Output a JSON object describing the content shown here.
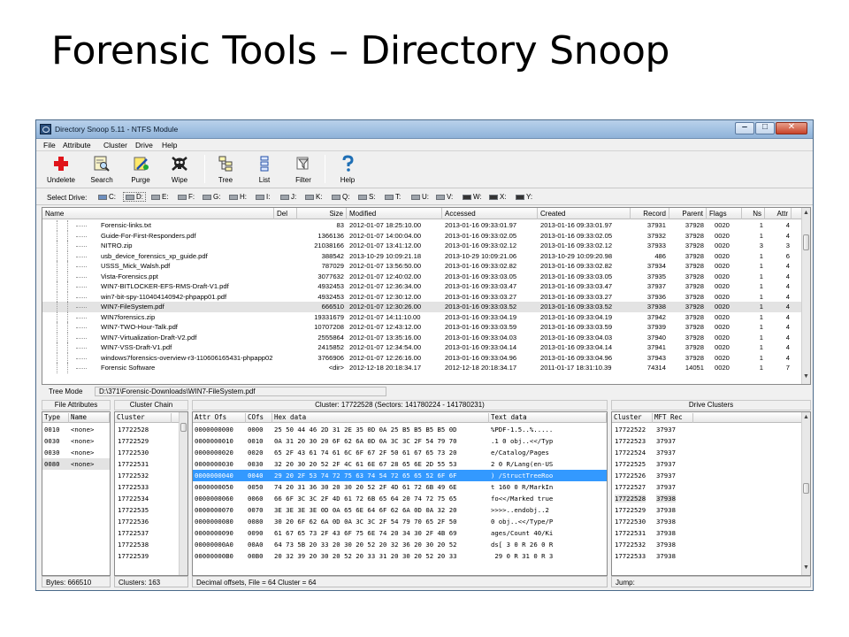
{
  "slide": {
    "title": "Forensic Tools – Directory Snoop"
  },
  "window": {
    "title": "Directory Snoop 5.11 - NTFS Module",
    "buttons": {
      "minimize": "‒",
      "maximize": "□",
      "close": "✕"
    }
  },
  "menu": [
    "File",
    "Attribute",
    "Cluster",
    "Drive",
    "Help"
  ],
  "toolbar": [
    {
      "label": "Undelete",
      "icon": "red-cross-icon"
    },
    {
      "label": "Search",
      "icon": "search-icon"
    },
    {
      "label": "Purge",
      "icon": "purge-icon"
    },
    {
      "label": "Wipe",
      "icon": "skull-icon"
    },
    {
      "label": "Tree",
      "icon": "tree-icon"
    },
    {
      "label": "List",
      "icon": "list-icon"
    },
    {
      "label": "Filter",
      "icon": "filter-icon"
    },
    {
      "label": "Help",
      "icon": "question-icon"
    }
  ],
  "drives": {
    "label": "Select Drive:",
    "items": [
      "C:",
      "D:",
      "E:",
      "F:",
      "G:",
      "H:",
      "I:",
      "J:",
      "K:",
      "Q:",
      "S:",
      "T:",
      "U:",
      "V:",
      "W:",
      "X:",
      "Y:"
    ],
    "selected": "C:"
  },
  "file_list": {
    "columns": [
      "Name",
      "Del",
      "Size",
      "Modified",
      "Accessed",
      "Created",
      "Record",
      "Parent",
      "Flags",
      "Ns",
      "Attr"
    ],
    "rows": [
      [
        "Forensic-links.txt",
        "",
        "83",
        "2012-01-07 18:25:10.00",
        "2013-01-16 09:33:01.97",
        "2013-01-16 09:33:01.97",
        "37931",
        "37928",
        "0020",
        "1",
        "4"
      ],
      [
        "Guide-For-First-Responders.pdf",
        "",
        "1366136",
        "2012-01-07 14:00:04.00",
        "2013-01-16 09:33:02.05",
        "2013-01-16 09:33:02.05",
        "37932",
        "37928",
        "0020",
        "1",
        "4"
      ],
      [
        "NITRO.zip",
        "",
        "21038166",
        "2012-01-07 13:41:12.00",
        "2013-01-16 09:33:02.12",
        "2013-01-16 09:33:02.12",
        "37933",
        "37928",
        "0020",
        "3",
        "3"
      ],
      [
        "usb_device_forensics_xp_guide.pdf",
        "",
        "388542",
        "2013-10-29 10:09:21.18",
        "2013-10-29 10:09:21.06",
        "2013-10-29 10:09:20.98",
        "486",
        "37928",
        "0020",
        "1",
        "6"
      ],
      [
        "USSS_Mick_Walsh.pdf",
        "",
        "787029",
        "2012-01-07 13:56:50.00",
        "2013-01-16 09:33:02.82",
        "2013-01-16 09:33:02.82",
        "37934",
        "37928",
        "0020",
        "1",
        "4"
      ],
      [
        "Vista-Forensics.ppt",
        "",
        "3077632",
        "2012-01-07 12:40:02.00",
        "2013-01-16 09:33:03.05",
        "2013-01-16 09:33:03.05",
        "37935",
        "37928",
        "0020",
        "1",
        "4"
      ],
      [
        "WIN7-BITLOCKER-EFS-RMS-Draft-V1.pdf",
        "",
        "4932453",
        "2012-01-07 12:36:34.00",
        "2013-01-16 09:33:03.47",
        "2013-01-16 09:33:03.47",
        "37937",
        "37928",
        "0020",
        "1",
        "4"
      ],
      [
        "win7-bit-spy-110404140942-phpapp01.pdf",
        "",
        "4932453",
        "2012-01-07 12:30:12.00",
        "2013-01-16 09:33:03.27",
        "2013-01-16 09:33:03.27",
        "37936",
        "37928",
        "0020",
        "1",
        "4"
      ],
      [
        "WIN7-FileSystem.pdf",
        "",
        "666510",
        "2012-01-07 12:30:26.00",
        "2013-01-16 09:33:03.52",
        "2013-01-16 09:33:03.52",
        "37938",
        "37928",
        "0020",
        "1",
        "4"
      ],
      [
        "WIN7forensics.zip",
        "",
        "19331679",
        "2012-01-07 14:11:10.00",
        "2013-01-16 09:33:04.19",
        "2013-01-16 09:33:04.19",
        "37942",
        "37928",
        "0020",
        "1",
        "4"
      ],
      [
        "WIN7-TWO-Hour-Talk.pdf",
        "",
        "10707208",
        "2012-01-07 12:43:12.00",
        "2013-01-16 09:33:03.59",
        "2013-01-16 09:33:03.59",
        "37939",
        "37928",
        "0020",
        "1",
        "4"
      ],
      [
        "WIN7-Virtualization-Draft-V2.pdf",
        "",
        "2555864",
        "2012-01-07 13:35:16.00",
        "2013-01-16 09:33:04.03",
        "2013-01-16 09:33:04.03",
        "37940",
        "37928",
        "0020",
        "1",
        "4"
      ],
      [
        "WIN7-VSS-Draft-V1.pdf",
        "",
        "2415852",
        "2012-01-07 12:34:54.00",
        "2013-01-16 09:33:04.14",
        "2013-01-16 09:33:04.14",
        "37941",
        "37928",
        "0020",
        "1",
        "4"
      ],
      [
        "windows7forensics-overview-r3-110606165431-phpapp02....",
        "",
        "3766906",
        "2012-01-07 12:26:16.00",
        "2013-01-16 09:33:04.96",
        "2013-01-16 09:33:04.96",
        "37943",
        "37928",
        "0020",
        "1",
        "4"
      ],
      [
        "Forensic Software",
        "",
        "<dir>",
        "2012-12-18 20:18:34.17",
        "2012-12-18 20:18:34.17",
        "2011-01-17 18:31:10.39",
        "74314",
        "14051",
        "0020",
        "1",
        "7"
      ]
    ],
    "selected_index": 8
  },
  "tree_mode": {
    "label": "Tree Mode",
    "path": "D:\\371\\Forensic-Downloads\\WIN7-FileSystem.pdf"
  },
  "file_attributes": {
    "title": "File Attributes",
    "columns": [
      "Type",
      "Name"
    ],
    "rows": [
      [
        "0010",
        "<none>"
      ],
      [
        "0030",
        "<none>"
      ],
      [
        "0030",
        "<none>"
      ],
      [
        "0080",
        "<none>"
      ]
    ],
    "selected_index": 3
  },
  "cluster_chain": {
    "title": "Cluster Chain",
    "column": "Cluster",
    "rows": [
      "17722528",
      "17722529",
      "17722530",
      "17722531",
      "17722532",
      "17722533",
      "17722534",
      "17722535",
      "17722536",
      "17722537",
      "17722538",
      "17722539"
    ]
  },
  "hex_view": {
    "title": "Cluster: 17722528  (Sectors: 141780224 - 141780231)",
    "columns": [
      "Attr Ofs",
      "COfs",
      "Hex data",
      "Text data"
    ],
    "rows": [
      [
        "0000000000",
        "0000",
        "25 50 44 46 2D 31 2E 35 0D 0A 25 B5 B5 B5 B5 0D",
        "%PDF-1.5..%....."
      ],
      [
        "0000000010",
        "0010",
        "0A 31 20 30 20 6F 62 6A 0D 0A 3C 3C 2F 54 79 70",
        ".1 0 obj..<</Typ"
      ],
      [
        "0000000020",
        "0020",
        "65 2F 43 61 74 61 6C 6F 67 2F 50 61 67 65 73 20",
        "e/Catalog/Pages "
      ],
      [
        "0000000030",
        "0030",
        "32 20 30 20 52 2F 4C 61 6E 67 28 65 6E 2D 55 53",
        "2 0 R/Lang(en-US"
      ],
      [
        "0000000040",
        "0040",
        "29 20 2F 53 74 72 75 63 74 54 72 65 65 52 6F 6F",
        ") /StructTreeRoo"
      ],
      [
        "0000000050",
        "0050",
        "74 20 31 36 30 20 30 20 52 2F 4D 61 72 6B 49 6E",
        "t 160 0 R/MarkIn"
      ],
      [
        "0000000060",
        "0060",
        "66 6F 3C 3C 2F 4D 61 72 6B 65 64 20 74 72 75 65",
        "fo<</Marked true"
      ],
      [
        "0000000070",
        "0070",
        "3E 3E 3E 3E 0D 0A 65 6E 64 6F 62 6A 0D 0A 32 20",
        ">>>>..endobj..2 "
      ],
      [
        "0000000080",
        "0080",
        "30 20 6F 62 6A 0D 0A 3C 3C 2F 54 79 70 65 2F 50",
        "0 obj..<</Type/P"
      ],
      [
        "0000000090",
        "0090",
        "61 67 65 73 2F 43 6F 75 6E 74 20 34 30 2F 4B 69",
        "ages/Count 40/Ki"
      ],
      [
        "00000000A0",
        "00A0",
        "64 73 5B 20 33 20 30 20 52 20 32 36 20 30 20 52",
        "ds[ 3 0 R 26 0 R"
      ],
      [
        "00000000B0",
        "00B0",
        "20 32 39 20 30 20 52 20 33 31 20 30 20 52 20 33",
        " 29 0 R 31 0 R 3"
      ]
    ],
    "selected_index": 4
  },
  "drive_clusters": {
    "title": "Drive Clusters",
    "columns": [
      "Cluster",
      "MFT Rec"
    ],
    "rows": [
      [
        "17722522",
        "37937"
      ],
      [
        "17722523",
        "37937"
      ],
      [
        "17722524",
        "37937"
      ],
      [
        "17722525",
        "37937"
      ],
      [
        "17722526",
        "37937"
      ],
      [
        "17722527",
        "37937"
      ],
      [
        "17722528",
        "37938"
      ],
      [
        "17722529",
        "37938"
      ],
      [
        "17722530",
        "37938"
      ],
      [
        "17722531",
        "37938"
      ],
      [
        "17722532",
        "37938"
      ],
      [
        "17722533",
        "37938"
      ]
    ],
    "selected_index": 6
  },
  "status": {
    "bytes": "Bytes: 666510",
    "clusters": "Clusters: 163",
    "offsets": "Decimal offsets, File = 64  Cluster = 64",
    "jump": "Jump:"
  },
  "colors": {
    "selection": "#3399ff",
    "titlebar": "#a6c4e4",
    "row_highlight": "#e3e3e3"
  }
}
